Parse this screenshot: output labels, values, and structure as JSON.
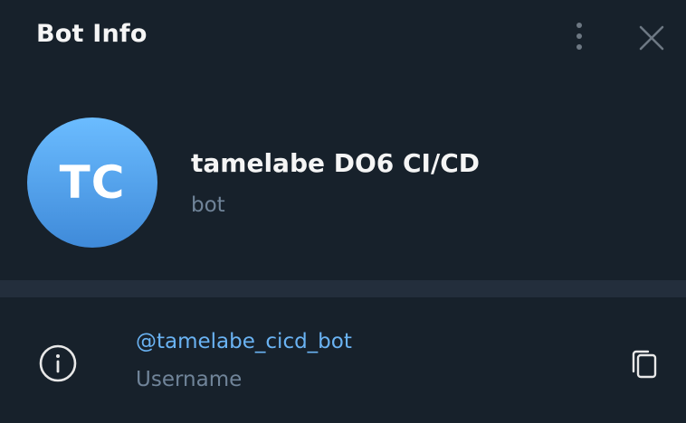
{
  "header": {
    "title": "Bot Info",
    "more_icon": "more-vertical-icon",
    "close_icon": "close-icon"
  },
  "profile": {
    "avatar_initials": "TC",
    "name": "tamelabe DO6 CI/CD",
    "status": "bot"
  },
  "info": {
    "icon": "info-icon",
    "username": "@tamelabe_cicd_bot",
    "username_label": "Username",
    "copy_icon": "copy-icon"
  },
  "colors": {
    "background": "#17212b",
    "divider": "#232e3c",
    "accent": "#6ab3f3",
    "secondary_text": "#708499",
    "avatar_top": "#6bbcff",
    "avatar_bottom": "#3f8ad9"
  }
}
